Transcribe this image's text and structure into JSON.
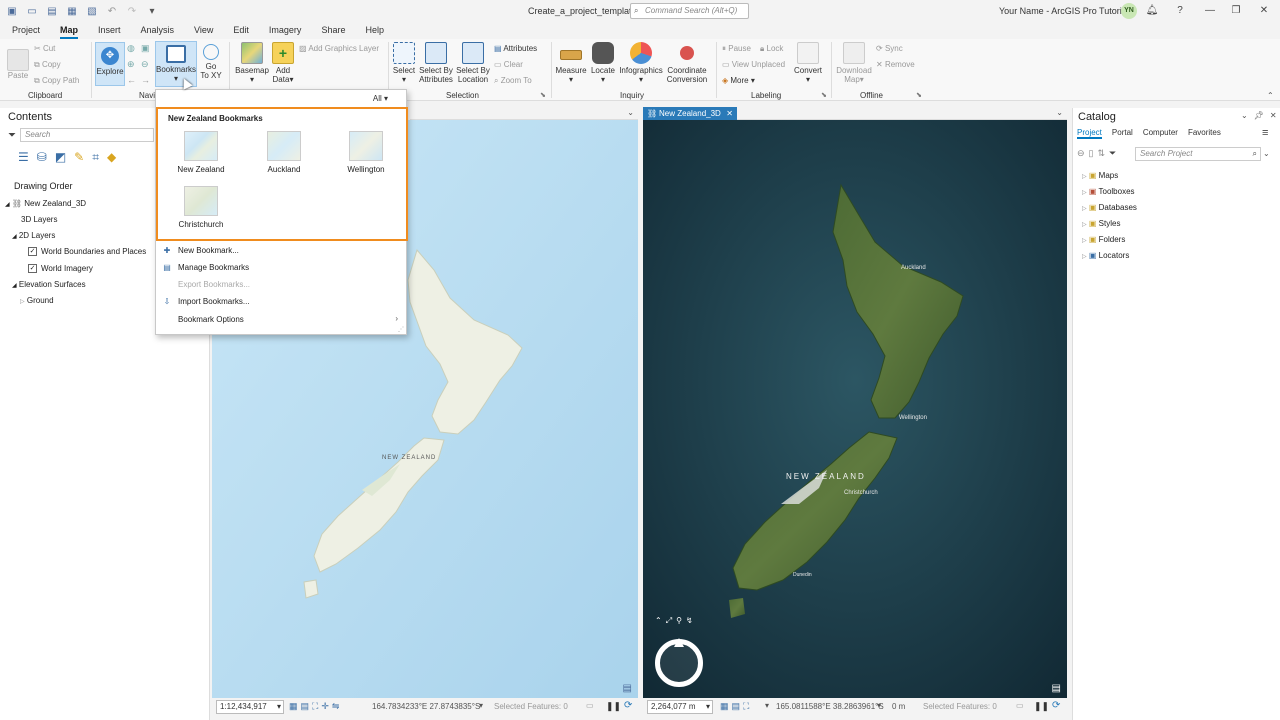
{
  "titlebar": {
    "document_title": "Create_a_project_template",
    "command_search_placeholder": "Command Search (Alt+Q)",
    "user_title": "Your Name - ArcGIS Pro Tutorials",
    "user_initials": "YN"
  },
  "ribbon_tabs": [
    "Project",
    "Map",
    "Insert",
    "Analysis",
    "View",
    "Edit",
    "Imagery",
    "Share",
    "Help"
  ],
  "active_tab": "Map",
  "ribbon": {
    "clipboard": {
      "paste": "Paste",
      "cut": "Cut",
      "copy": "Copy",
      "copy_path": "Copy Path",
      "group": "Clipboard"
    },
    "navigate": {
      "explore": "Explore",
      "bookmarks": "Bookmarks",
      "go_to_xy_1": "Go",
      "go_to_xy_2": "To XY",
      "group": "Navi"
    },
    "layer": {
      "basemap": "Basemap",
      "add_data_1": "Add",
      "add_data_2": "Data",
      "add_graphics_layer": "Add Graphics Layer"
    },
    "selection": {
      "select": "Select",
      "select_by_attributes_1": "Select By",
      "select_by_attributes_2": "Attributes",
      "select_by_location_1": "Select By",
      "select_by_location_2": "Location",
      "attributes": "Attributes",
      "clear": "Clear",
      "zoom_to": "Zoom To",
      "group": "Selection"
    },
    "inquiry": {
      "measure": "Measure",
      "locate": "Locate",
      "infographics": "Infographics",
      "coordinate_conversion_1": "Coordinate",
      "coordinate_conversion_2": "Conversion",
      "group": "Inquiry"
    },
    "labeling": {
      "pause": "Pause",
      "lock": "Lock",
      "view_unplaced": "View Unplaced",
      "more": "More",
      "convert": "Convert",
      "group": "Labeling"
    },
    "offline": {
      "download_map_1": "Download",
      "download_map_2": "Map",
      "sync": "Sync",
      "remove": "Remove",
      "group": "Offline"
    }
  },
  "contents": {
    "title": "Contents",
    "search_placeholder": "Search",
    "drawing_order": "Drawing Order",
    "map_name": "New Zealand_3D",
    "layers_3d": "3D Layers",
    "layers_2d": "2D Layers",
    "layer_boundaries": "World Boundaries and Places",
    "layer_imagery": "World Imagery",
    "elevation_surfaces": "Elevation Surfaces",
    "ground": "Ground"
  },
  "bookmarks_dropdown": {
    "filter": "All",
    "gallery_title": "New Zealand Bookmarks",
    "bookmarks": [
      "New Zealand",
      "Auckland",
      "Wellington",
      "Christchurch"
    ],
    "menu": {
      "new_bookmark": "New Bookmark...",
      "manage_bookmarks": "Manage Bookmarks",
      "export_bookmarks": "Export Bookmarks...",
      "import_bookmarks": "Import Bookmarks...",
      "bookmark_options": "Bookmark Options"
    }
  },
  "map_view_3d_tab": "New Zealand_3D",
  "map2d": {
    "country_label": "NEW ZEALAND",
    "scale": "1:12,434,917",
    "coordinates": "164.7834233°E 27.8743835°S",
    "selected_features": "Selected Features: 0"
  },
  "map3d": {
    "country_label": "NEW ZEALAND",
    "auckland": "Auckland",
    "wellington": "Wellington",
    "christchurch": "Christchurch",
    "dunedin": "Dunedin",
    "scale": "2,264,077 m",
    "coordinates": "165.0811588°E 38.2863961°S",
    "elevation": "0 m",
    "selected_features": "Selected Features: 0"
  },
  "catalog": {
    "title": "Catalog",
    "tabs": [
      "Project",
      "Portal",
      "Computer",
      "Favorites"
    ],
    "search_placeholder": "Search Project",
    "items": [
      "Maps",
      "Toolboxes",
      "Databases",
      "Styles",
      "Folders",
      "Locators"
    ]
  }
}
